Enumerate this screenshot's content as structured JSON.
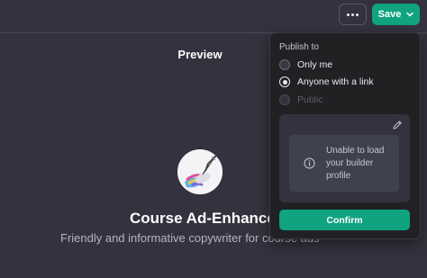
{
  "header": {
    "more_icon": "ellipsis-icon",
    "save_label": "Save",
    "save_icon": "chevron-down-icon",
    "accent": "#10a37f"
  },
  "preview": {
    "title": "Preview",
    "gpt_name": "Course Ad-Enhancer",
    "gpt_description": "Friendly and informative copywriter for course ads"
  },
  "publish_menu": {
    "heading": "Publish to",
    "options": [
      {
        "label": "Only me",
        "selected": false,
        "disabled": false
      },
      {
        "label": "Anyone with a link",
        "selected": true,
        "disabled": false
      },
      {
        "label": "Public",
        "selected": false,
        "disabled": true
      }
    ],
    "profile_card": {
      "edit_icon": "pencil-icon",
      "info_icon": "info-icon",
      "message": "Unable to load your builder profile"
    },
    "confirm_label": "Confirm"
  }
}
